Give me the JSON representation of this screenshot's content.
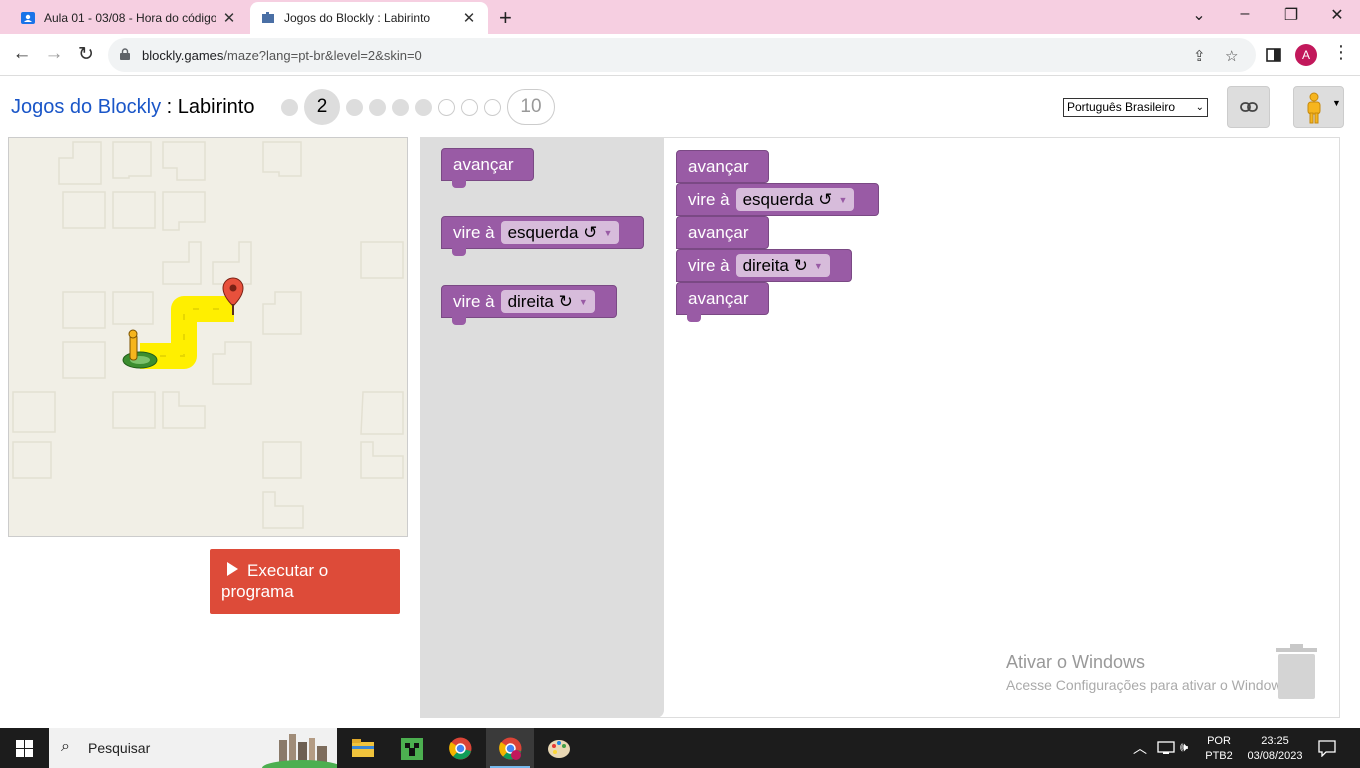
{
  "browser": {
    "tabs": [
      {
        "title": "Aula 01 - 03/08 - Hora do código",
        "active": false
      },
      {
        "title": "Jogos do Blockly : Labirinto",
        "active": true
      }
    ],
    "url_host": "blockly.games",
    "url_path": "/maze?lang=pt-br&level=2&skin=0",
    "profile_initial": "A"
  },
  "header": {
    "brand": "Jogos do Blockly",
    "separator": " : ",
    "page": "Labirinto",
    "current_level": "2",
    "last_level": "10",
    "language": "Português Brasileiro"
  },
  "run_button": {
    "label": "Executar o programa"
  },
  "toolbox": {
    "blocks": [
      {
        "text": "avançar"
      },
      {
        "text": "vire à",
        "dropdown": "esquerda ↺"
      },
      {
        "text": "vire à",
        "dropdown": "direita ↻"
      }
    ]
  },
  "program": {
    "blocks": [
      {
        "text": "avançar"
      },
      {
        "text": "vire à",
        "dropdown": "esquerda ↺"
      },
      {
        "text": "avançar"
      },
      {
        "text": "vire à",
        "dropdown": "direita ↻"
      },
      {
        "text": "avançar"
      }
    ]
  },
  "watermark": {
    "title": "Ativar o Windows",
    "subtitle": "Acesse Configurações para ativar o Windows."
  },
  "taskbar": {
    "search_placeholder": "Pesquisar",
    "lang_top": "POR",
    "lang_bottom": "PTB2",
    "time": "23:25",
    "date": "03/08/2023"
  },
  "colors": {
    "block": "#995ba5",
    "run_button": "#dd4b39",
    "link": "#1a56c8",
    "path": "#ffef00"
  }
}
